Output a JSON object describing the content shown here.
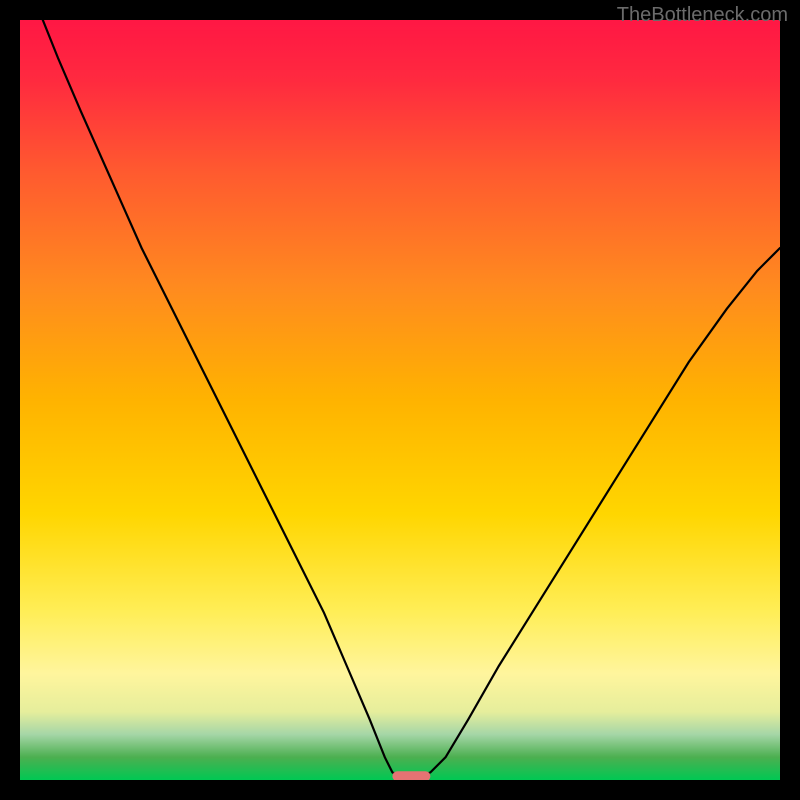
{
  "watermark": "TheBottleneck.com",
  "chart_data": {
    "type": "line",
    "title": "",
    "xlabel": "",
    "ylabel": "",
    "xlim": [
      0,
      100
    ],
    "ylim": [
      0,
      100
    ],
    "gradient_stops": [
      {
        "offset": 0.0,
        "color": "#ff1744"
      },
      {
        "offset": 0.08,
        "color": "#ff2a3f"
      },
      {
        "offset": 0.2,
        "color": "#ff5a2f"
      },
      {
        "offset": 0.35,
        "color": "#ff8a1f"
      },
      {
        "offset": 0.5,
        "color": "#ffb300"
      },
      {
        "offset": 0.65,
        "color": "#ffd600"
      },
      {
        "offset": 0.78,
        "color": "#ffee58"
      },
      {
        "offset": 0.86,
        "color": "#fff59d"
      },
      {
        "offset": 0.91,
        "color": "#e6ee9c"
      },
      {
        "offset": 0.94,
        "color": "#a5d6a7"
      },
      {
        "offset": 0.97,
        "color": "#4caf50"
      },
      {
        "offset": 1.0,
        "color": "#00c853"
      }
    ],
    "series": [
      {
        "name": "bottleneck-curve",
        "points": [
          {
            "x": 3.0,
            "y": 100.0
          },
          {
            "x": 5.0,
            "y": 95.0
          },
          {
            "x": 8.0,
            "y": 88.0
          },
          {
            "x": 12.0,
            "y": 79.0
          },
          {
            "x": 16.0,
            "y": 70.0
          },
          {
            "x": 20.0,
            "y": 62.0
          },
          {
            "x": 24.0,
            "y": 54.0
          },
          {
            "x": 28.0,
            "y": 46.0
          },
          {
            "x": 32.0,
            "y": 38.0
          },
          {
            "x": 36.0,
            "y": 30.0
          },
          {
            "x": 40.0,
            "y": 22.0
          },
          {
            "x": 43.0,
            "y": 15.0
          },
          {
            "x": 46.0,
            "y": 8.0
          },
          {
            "x": 48.0,
            "y": 3.0
          },
          {
            "x": 49.0,
            "y": 1.0
          },
          {
            "x": 50.0,
            "y": 0.5
          },
          {
            "x": 51.0,
            "y": 0.5
          },
          {
            "x": 52.0,
            "y": 0.5
          },
          {
            "x": 53.0,
            "y": 0.5
          },
          {
            "x": 54.0,
            "y": 1.0
          },
          {
            "x": 56.0,
            "y": 3.0
          },
          {
            "x": 59.0,
            "y": 8.0
          },
          {
            "x": 63.0,
            "y": 15.0
          },
          {
            "x": 68.0,
            "y": 23.0
          },
          {
            "x": 73.0,
            "y": 31.0
          },
          {
            "x": 78.0,
            "y": 39.0
          },
          {
            "x": 83.0,
            "y": 47.0
          },
          {
            "x": 88.0,
            "y": 55.0
          },
          {
            "x": 93.0,
            "y": 62.0
          },
          {
            "x": 97.0,
            "y": 67.0
          },
          {
            "x": 100.0,
            "y": 70.0
          }
        ]
      }
    ],
    "marker": {
      "name": "optimal-marker",
      "x_start": 49.0,
      "x_end": 54.0,
      "y": 0.5,
      "color": "#e57373"
    }
  }
}
